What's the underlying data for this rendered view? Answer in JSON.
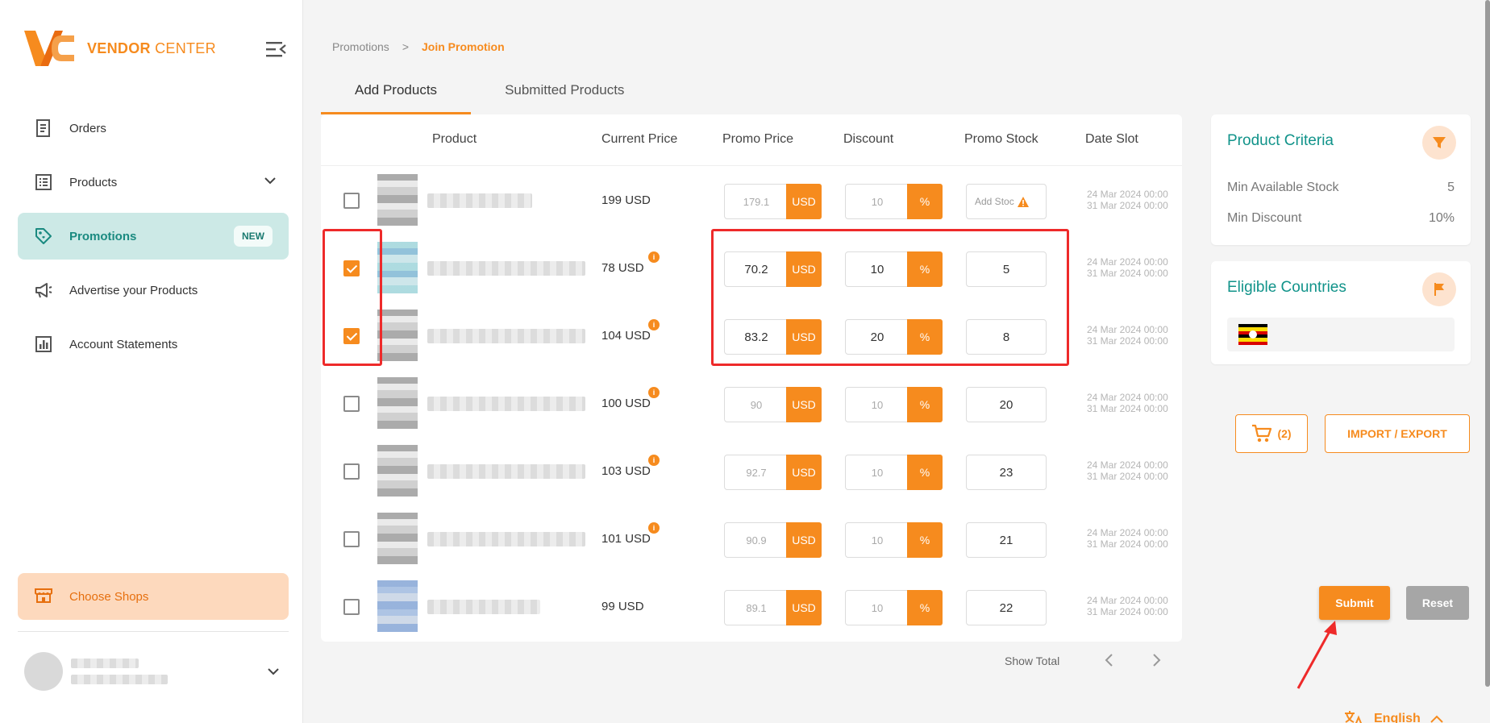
{
  "brand": {
    "name_bold": "VENDOR",
    "name_thin": " CENTER",
    "color": "#f68b1e"
  },
  "sidebar": {
    "items": [
      {
        "label": "Orders",
        "icon": "receipt-icon"
      },
      {
        "label": "Products",
        "icon": "list-icon"
      },
      {
        "label": "Promotions",
        "icon": "tag-icon",
        "badge": "NEW",
        "active": true
      },
      {
        "label": "Advertise your Products",
        "icon": "megaphone-icon"
      },
      {
        "label": "Account Statements",
        "icon": "chart-icon"
      }
    ],
    "choose_shops": "Choose Shops"
  },
  "breadcrumb": {
    "root": "Promotions",
    "sep": ">",
    "current": "Join Promotion"
  },
  "tabs": [
    "Add Products",
    "Submitted Products"
  ],
  "table": {
    "headers": [
      "Product",
      "Current Price",
      "Promo Price",
      "Discount",
      "Promo Stock",
      "Date Slot"
    ],
    "currency_suffix": "USD",
    "percent_suffix": "%",
    "rows": [
      {
        "checked": false,
        "price": "199 USD",
        "info": false,
        "promo": "179.1",
        "discount": "10",
        "stock": "Add Stoc",
        "stock_placeholder": true,
        "date_start": "24 Mar 2024 00:00",
        "date_end": "31 Mar 2024 00:00"
      },
      {
        "checked": true,
        "price": "78 USD",
        "info": true,
        "promo": "70.2",
        "discount": "10",
        "stock": "5",
        "date_start": "24 Mar 2024 00:00",
        "date_end": "31 Mar 2024 00:00"
      },
      {
        "checked": true,
        "price": "104 USD",
        "info": true,
        "promo": "83.2",
        "discount": "20",
        "stock": "8",
        "date_start": "24 Mar 2024 00:00",
        "date_end": "31 Mar 2024 00:00"
      },
      {
        "checked": false,
        "price": "100 USD",
        "info": true,
        "promo": "90",
        "discount": "10",
        "stock": "20",
        "date_start": "24 Mar 2024 00:00",
        "date_end": "31 Mar 2024 00:00"
      },
      {
        "checked": false,
        "price": "103 USD",
        "info": true,
        "promo": "92.7",
        "discount": "10",
        "stock": "23",
        "date_start": "24 Mar 2024 00:00",
        "date_end": "31 Mar 2024 00:00"
      },
      {
        "checked": false,
        "price": "101 USD",
        "info": true,
        "promo": "90.9",
        "discount": "10",
        "stock": "21",
        "date_start": "24 Mar 2024 00:00",
        "date_end": "31 Mar 2024 00:00"
      },
      {
        "checked": false,
        "price": "99 USD",
        "info": false,
        "promo": "89.1",
        "discount": "10",
        "stock": "22",
        "date_start": "24 Mar 2024 00:00",
        "date_end": "31 Mar 2024 00:00"
      }
    ],
    "show_total": "Show Total"
  },
  "criteria": {
    "title": "Product Criteria",
    "rows": [
      {
        "label": "Min Available Stock",
        "value": "5"
      },
      {
        "label": "Min Discount",
        "value": "10%"
      }
    ]
  },
  "countries": {
    "title": "Eligible Countries"
  },
  "actions": {
    "cart": "(2)",
    "import_export": "IMPORT / EXPORT",
    "submit": "Submit",
    "reset": "Reset"
  },
  "language": "English"
}
